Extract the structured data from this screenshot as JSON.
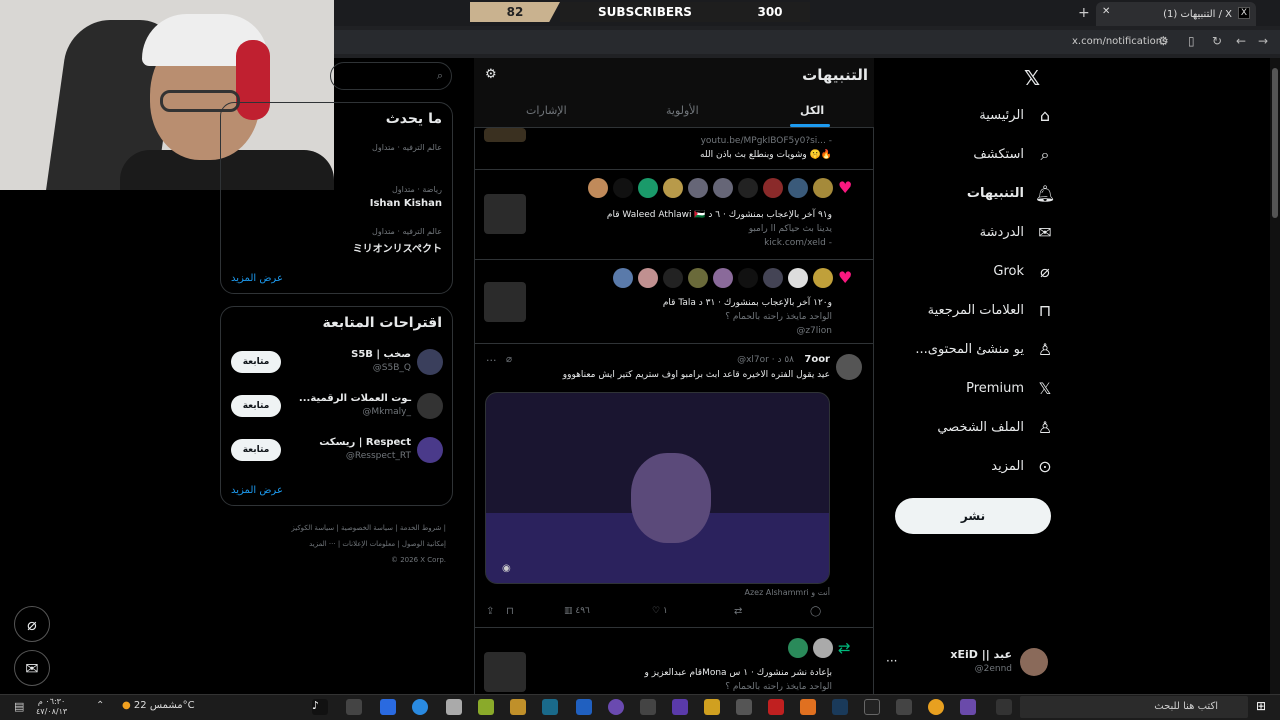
{
  "browser": {
    "tab_title": "(1) التنبيهات / X",
    "url": "x.com/notifications"
  },
  "overlay": {
    "left_value": "82",
    "label": "SUBSCRIBERS",
    "right_value": "300"
  },
  "page": {
    "title": "التنبيهات",
    "tabs": [
      "الكل",
      "الأولوية",
      "الإشارات"
    ]
  },
  "search": {
    "placeholder": ""
  },
  "trends": {
    "title": "ما يحدث",
    "items": [
      {
        "meta": "عالم الترفيه · متداول",
        "name": ""
      },
      {
        "meta": "رياضة · متداول",
        "name": "Ishan Kishan"
      },
      {
        "meta": "عالم الترفيه · متداول",
        "name": "ミリオンリスペクト"
      }
    ],
    "more": "عرض المزيد"
  },
  "suggestions": {
    "title": "اقتراحات المتابعة",
    "items": [
      {
        "name": "S5B | صخب",
        "handle": "@S5B_Q",
        "follow": "متابعة"
      },
      {
        "name": "...ـوت العملات الرقمية",
        "handle": "@Mkmaly_",
        "follow": "متابعة"
      },
      {
        "name": "ريسكت | Respect",
        "handle": "@Resspect_RT",
        "follow": "متابعة"
      }
    ],
    "more": "عرض المزيد"
  },
  "footer": {
    "line1": "شروط الخدمة | سياسة الخصوصية | سياسة الكوكيز |",
    "line2": "إمكانية الوصول | معلومات الإعلانات | ··· المزيد",
    "line3": "© 2026 X Corp."
  },
  "notifications": [
    {
      "text": "youtu.be/MPgkIBOF5y0?si... -",
      "sub": "وشويات وبنطلع بث باذن الله 🤫🔥"
    },
    {
      "text": "قام Waleed Athlawi 🇵🇸 و٩١ آخر بالإعجاب بمنشورك · ٦ د",
      "sub": "يدينا بث حياكم اا رامبو",
      "sub2": "kick.com/xeld -"
    },
    {
      "text": "قام Tala و١٢٠ آخر بالإعجاب بمنشورك · ٣١ د",
      "sub": "الواحد مايخذ راحته بالحمام ؟",
      "sub2": "@z7lion"
    },
    {
      "text": "قام عبدالعزيز وMona بإعادة نشر منشورك · ١ س",
      "sub": "الواحد مايخذ راحته بالحمام ؟"
    }
  ],
  "post": {
    "author": "7oor",
    "handle": "@xl7or · ٥٨ د",
    "text": "عيد يقول الفتره الاخيره قاعد ابث برامبو اوف ستريم كتير ايش معناهووو",
    "caption": "Azez Alshammri أنت و",
    "views": "٤٩٦",
    "likes": "١"
  },
  "nav": {
    "items": [
      "الرئيسية",
      "استكشف",
      "التنبيهات",
      "الدردشة",
      "Grok",
      "العلامات المرجعية",
      "...يو منشئ المحتوى",
      "Premium",
      "الملف الشخصي",
      "المزيد"
    ],
    "post_button": "نشر"
  },
  "profile": {
    "name": "xEiD || عبد",
    "handle": "@2ennd"
  },
  "taskbar": {
    "search": "اكتب هنا للبحث",
    "weather": "مشمس 22°C",
    "time": "٠٦:٣٠ م",
    "date": "٤٧/٠٨/١٣"
  },
  "colors": {
    "accent": "#1d9bf0",
    "like": "#f91880",
    "retweet": "#00ba7c"
  }
}
